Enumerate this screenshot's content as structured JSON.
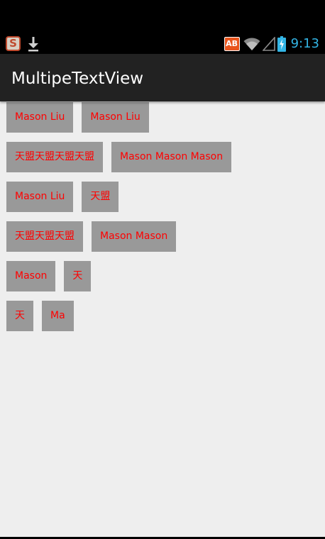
{
  "status_bar": {
    "left_icons": [
      "sogou-icon",
      "download-icon"
    ],
    "sogou_glyph": "S",
    "ab_badge": "AB",
    "right_icons": [
      "wifi-icon",
      "signal-icon",
      "battery-charging-icon"
    ],
    "time": "9:13",
    "clock_color": "#33b5e5"
  },
  "action_bar": {
    "title": "MultipeTextView",
    "background": "#222222"
  },
  "content": {
    "background": "#eeeeee",
    "tag_background": "#999999",
    "tag_text_color": "#ff0000",
    "rows": [
      [
        "Mason Liu",
        "Mason Liu"
      ],
      [
        "天盟天盟天盟天盟",
        "Mason Mason Mason"
      ],
      [
        "Mason Liu",
        "天盟"
      ],
      [
        "天盟天盟天盟",
        "Mason Mason"
      ],
      [
        "Mason",
        "天"
      ],
      [
        "天",
        "Ma"
      ]
    ]
  }
}
